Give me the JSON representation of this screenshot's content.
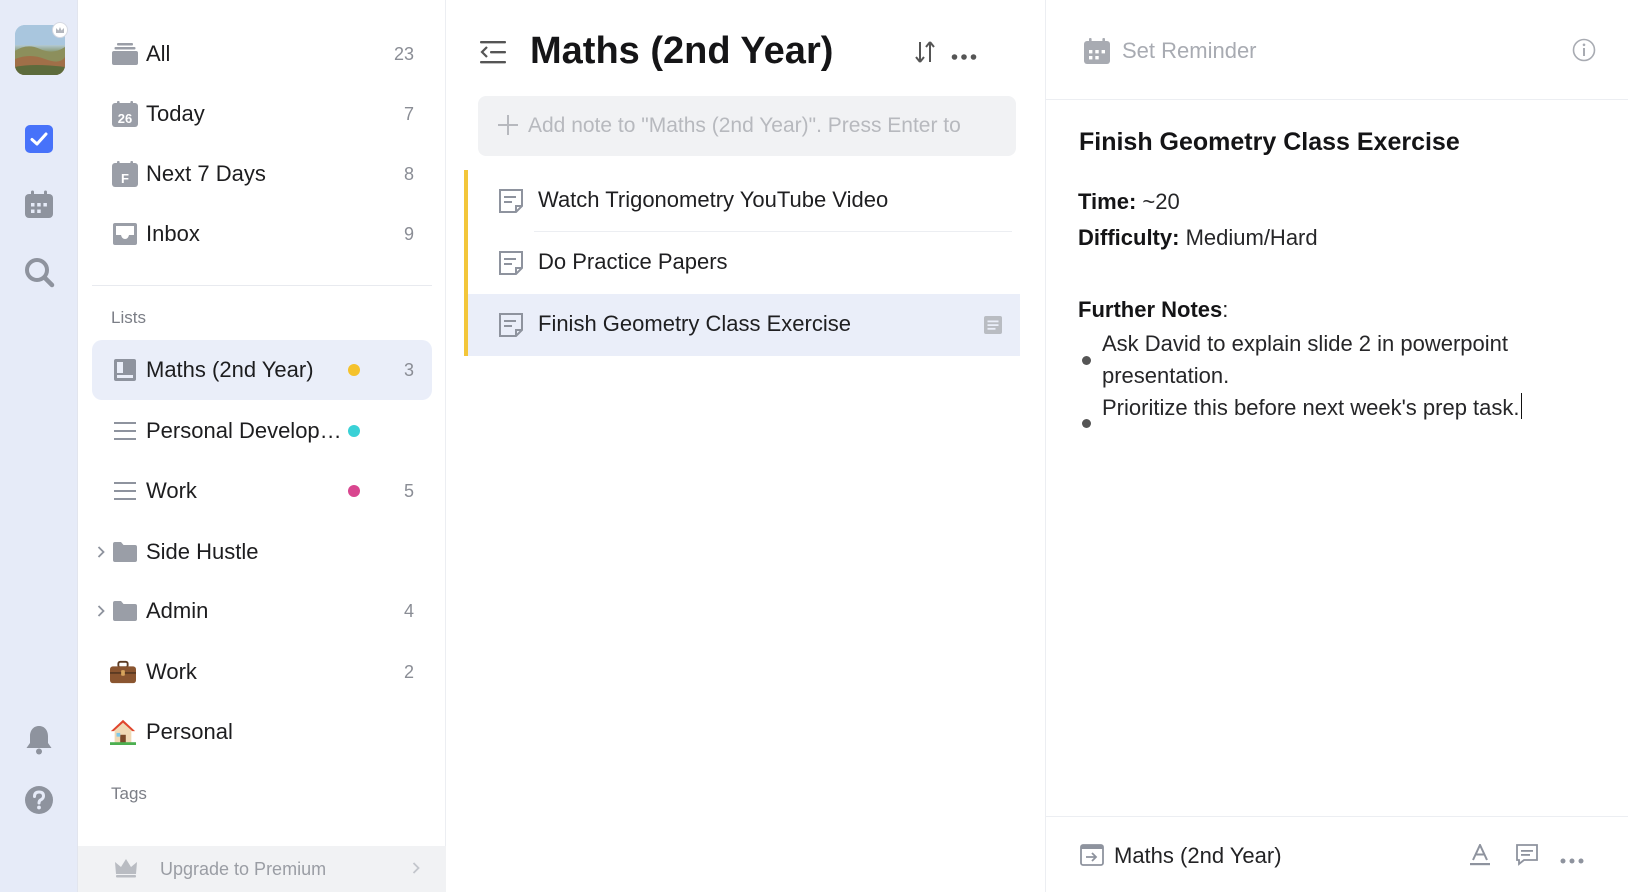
{
  "smart_lists": [
    {
      "label": "All",
      "count": "23"
    },
    {
      "label": "Today",
      "count": "7",
      "date_badge": "26"
    },
    {
      "label": "Next 7 Days",
      "count": "8",
      "date_badge": "F"
    },
    {
      "label": "Inbox",
      "count": "9"
    }
  ],
  "sections": {
    "lists": "Lists",
    "tags": "Tags"
  },
  "lists": [
    {
      "label": "Maths (2nd Year)",
      "count": "3",
      "dot_color": "#f5c22c",
      "icon": "list-board-icon"
    },
    {
      "label": "Personal Developm...",
      "count": "",
      "dot_color": "#3ad1d6",
      "icon": "list-lines-icon"
    },
    {
      "label": "Work",
      "count": "5",
      "dot_color": "#d9468f",
      "icon": "list-lines-icon"
    },
    {
      "label": "Side Hustle",
      "count": "",
      "icon": "folder-icon"
    },
    {
      "label": "Admin",
      "count": "4",
      "icon": "folder-icon"
    },
    {
      "label": "Work",
      "count": "2",
      "icon": "briefcase-emoji"
    },
    {
      "label": "Personal",
      "count": "",
      "icon": "house-emoji"
    }
  ],
  "upgrade": {
    "label": "Upgrade to Premium"
  },
  "list_view": {
    "title": "Maths (2nd Year)",
    "add_placeholder": "Add note to \"Maths (2nd Year)\". Press Enter to",
    "tasks": [
      {
        "label": "Watch Trigonometry YouTube Video"
      },
      {
        "label": "Do Practice Papers"
      },
      {
        "label": "Finish Geometry Class Exercise"
      }
    ],
    "accent": "#f3c63a"
  },
  "detail": {
    "reminder": "Set Reminder",
    "title": "Finish Geometry Class Exercise",
    "time_label": "Time:",
    "time_value": "~20",
    "difficulty_label": "Difficulty:",
    "difficulty_value": "Medium/Hard",
    "notes_label": "Further Notes",
    "notes_colon": ":",
    "bullets": [
      "Ask David to explain slide 2 in powerpoint presentation.",
      "Prioritize this before next week's prep task."
    ],
    "footer_list": "Maths (2nd Year)"
  },
  "colors": {
    "brand": "#4772fa",
    "selected_bg": "#eaeef9",
    "rail_bg": "#e6ebf8"
  }
}
